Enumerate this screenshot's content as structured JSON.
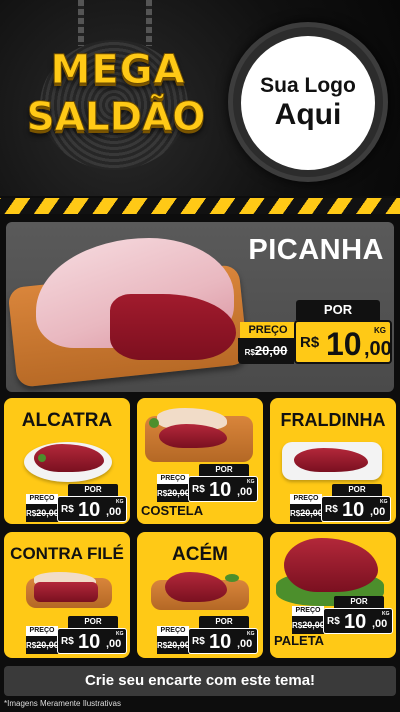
{
  "header": {
    "title_line1": "MEGA",
    "title_line2": "SALDÃO",
    "logo_line1": "Sua Logo",
    "logo_line2": "Aqui"
  },
  "featured": {
    "name": "PICANHA",
    "por_label": "POR",
    "preco_label": "PREÇO",
    "old_prefix": "R$",
    "old_price": "20,00",
    "currency": "R$",
    "price_int": "10",
    "price_cents": ",00",
    "unit": "KG"
  },
  "products": [
    {
      "name": "ALCATRA",
      "preco_label": "PREÇO",
      "old_prefix": "R$",
      "old_price": "20,00",
      "por_label": "POR",
      "currency": "R$",
      "price_int": "10",
      "price_cents": ",00",
      "unit": "KG"
    },
    {
      "name": "COSTELA",
      "preco_label": "PREÇO",
      "old_prefix": "R$",
      "old_price": "20,00",
      "por_label": "POR",
      "currency": "R$",
      "price_int": "10",
      "price_cents": ",00",
      "unit": "KG"
    },
    {
      "name": "FRALDINHA",
      "preco_label": "PREÇO",
      "old_prefix": "R$",
      "old_price": "20,00",
      "por_label": "POR",
      "currency": "R$",
      "price_int": "10",
      "price_cents": ",00",
      "unit": "KG"
    },
    {
      "name": "CONTRA FILÉ",
      "preco_label": "PREÇO",
      "old_prefix": "R$",
      "old_price": "20,00",
      "por_label": "POR",
      "currency": "R$",
      "price_int": "10",
      "price_cents": ",00",
      "unit": "KG"
    },
    {
      "name": "ACÉM",
      "preco_label": "PREÇO",
      "old_prefix": "R$",
      "old_price": "20,00",
      "por_label": "POR",
      "currency": "R$",
      "price_int": "10",
      "price_cents": ",00",
      "unit": "KG"
    },
    {
      "name": "PALETA",
      "preco_label": "PREÇO",
      "old_prefix": "R$",
      "old_price": "20,00",
      "por_label": "POR",
      "currency": "R$",
      "price_int": "10",
      "price_cents": ",00",
      "unit": "KG"
    }
  ],
  "cta_text": "Crie seu encarte com este tema!",
  "footnote": "*Imagens Meramente Ilustrativas",
  "colors": {
    "accent": "#ffc916",
    "dark": "#111111",
    "card_dark": "#3a3a3a",
    "hero_bg": "#515151"
  }
}
